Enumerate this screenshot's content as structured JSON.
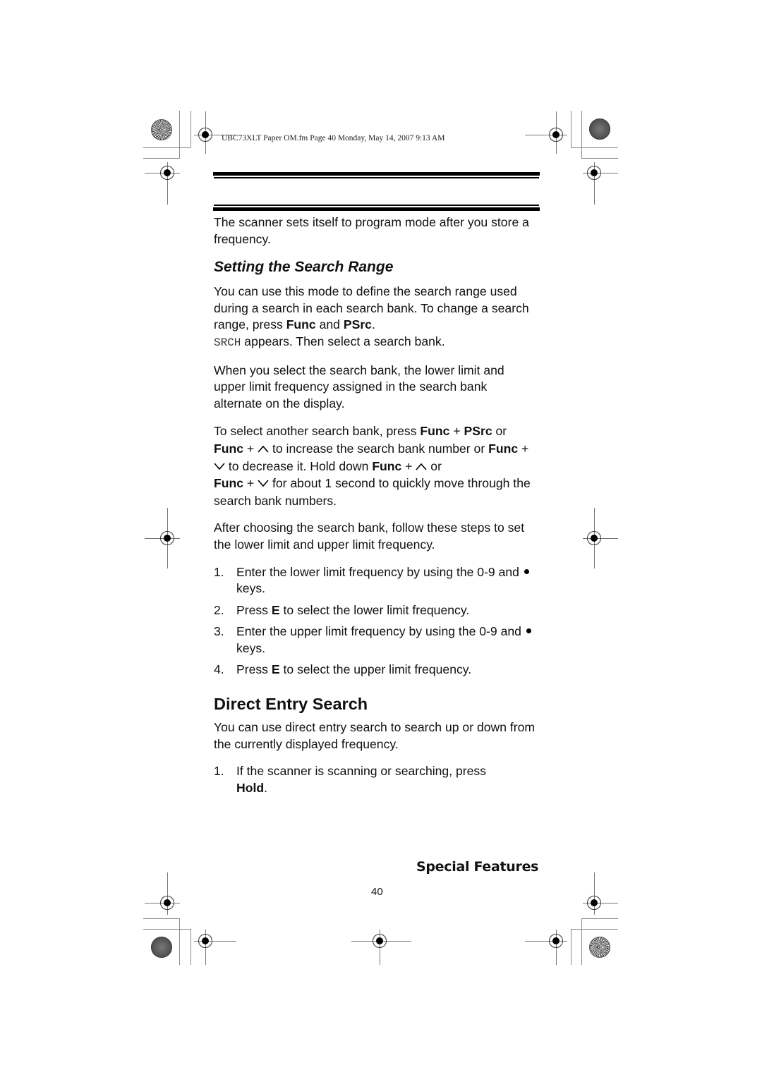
{
  "slug": "UBC73XLT Paper OM.fm  Page 40  Monday, May 14, 2007  9:13 AM",
  "intro": "The scanner sets itself to program mode after you store a frequency.",
  "section1": {
    "title": "Setting the Search Range",
    "p1": {
      "t1": "You can use this mode to define the search range used during a search in each search bank. To change a search range, press ",
      "k1": "Func",
      "t2": " and ",
      "k2": "PSrc",
      "t3": ".",
      "lcd": "SRCH",
      "t4": " appears. Then select a search bank."
    },
    "p2": "When you select the search bank, the lower limit and upper limit frequency assigned in the search bank alternate on the display.",
    "p3": {
      "t1": "To select another search bank, press ",
      "k1": "Func",
      "t2": " + ",
      "k2": "PSrc",
      "t3": " or ",
      "k3": "Func",
      "t4": " + ",
      "t5": "  to increase the search bank number or ",
      "k4": "Func",
      "t6": " + ",
      "t7": " to decrease it. Hold down ",
      "k5": "Func",
      "t8": " + ",
      "t9": " or ",
      "k6": "Func",
      "t10": " + ",
      "t11": " for about 1 second to quickly move through the search bank numbers."
    },
    "p4": "After choosing the search bank, follow these steps to set the lower limit and upper limit frequency.",
    "steps": [
      {
        "num": "1.",
        "t1": "Enter the lower limit frequency by using the 0-9 and ",
        "t2": " keys."
      },
      {
        "num": "2.",
        "t1": "Press ",
        "key": "E",
        "t2": " to select the lower limit frequency."
      },
      {
        "num": "3.",
        "t1": "Enter the upper limit frequency by using the 0-9 and ",
        "t2": " keys."
      },
      {
        "num": "4.",
        "t1": "Press ",
        "key": "E",
        "t2": " to select the upper limit frequency."
      }
    ]
  },
  "section2": {
    "title": "Direct Entry Search",
    "p1": "You can use direct entry search to search up or down from the currently displayed frequency.",
    "steps": [
      {
        "num": "1.",
        "t1": "If the scanner is scanning or searching, press ",
        "key": "Hold",
        "t2": "."
      }
    ]
  },
  "footer": {
    "section_title": "Special Features",
    "page_number": "40"
  },
  "icons": {
    "up": "chevron-up-icon",
    "down": "chevron-down-icon",
    "dot": "dot-key-icon",
    "registration": "registration-mark-icon",
    "starburst": "starburst-target-icon"
  }
}
